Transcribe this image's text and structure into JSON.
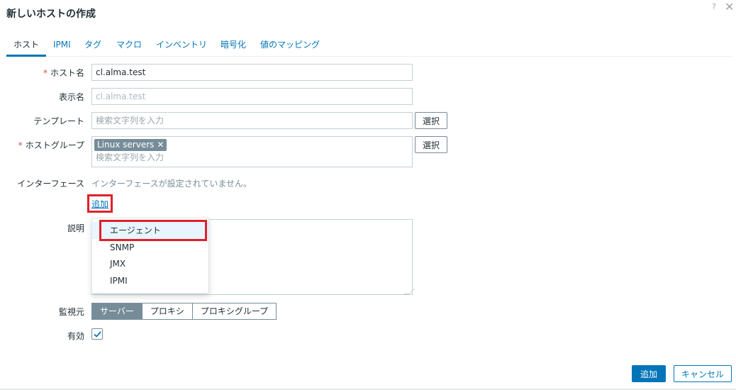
{
  "dialog": {
    "title": "新しいホストの作成",
    "help": "?",
    "close": "✕"
  },
  "tabs": [
    {
      "label": "ホスト"
    },
    {
      "label": "IPMI"
    },
    {
      "label": "タグ"
    },
    {
      "label": "マクロ"
    },
    {
      "label": "インベントリ"
    },
    {
      "label": "暗号化"
    },
    {
      "label": "値のマッピング"
    }
  ],
  "form": {
    "required_mark": "*",
    "hostname": {
      "label": "ホスト名",
      "value": "cl.alma.test"
    },
    "visible_name": {
      "label": "表示名",
      "placeholder": "cl.alma.test"
    },
    "templates": {
      "label": "テンプレート",
      "placeholder": "検索文字列を入力",
      "select_label": "選択"
    },
    "host_groups": {
      "label": "ホストグループ",
      "chip": "Linux servers",
      "chip_remove": "✕",
      "placeholder": "検索文字列を入力",
      "select_label": "選択"
    },
    "interfaces": {
      "label": "インターフェース",
      "empty_text": "インターフェースが設定されていません。",
      "add_label": "追加"
    },
    "description": {
      "label": "説明"
    },
    "monitored_by": {
      "label": "監視元",
      "options": [
        "サーバー",
        "プロキシ",
        "プロキシグループ"
      ],
      "selected": "サーバー"
    },
    "enabled": {
      "label": "有効",
      "checked": true
    }
  },
  "dropdown": {
    "items": [
      "エージェント",
      "SNMP",
      "JMX",
      "IPMI"
    ]
  },
  "footer": {
    "add_label": "追加",
    "cancel_label": "キャンセル"
  },
  "colors": {
    "accent": "#0275b8",
    "highlight": "#e0202a",
    "chip": "#768d99"
  }
}
